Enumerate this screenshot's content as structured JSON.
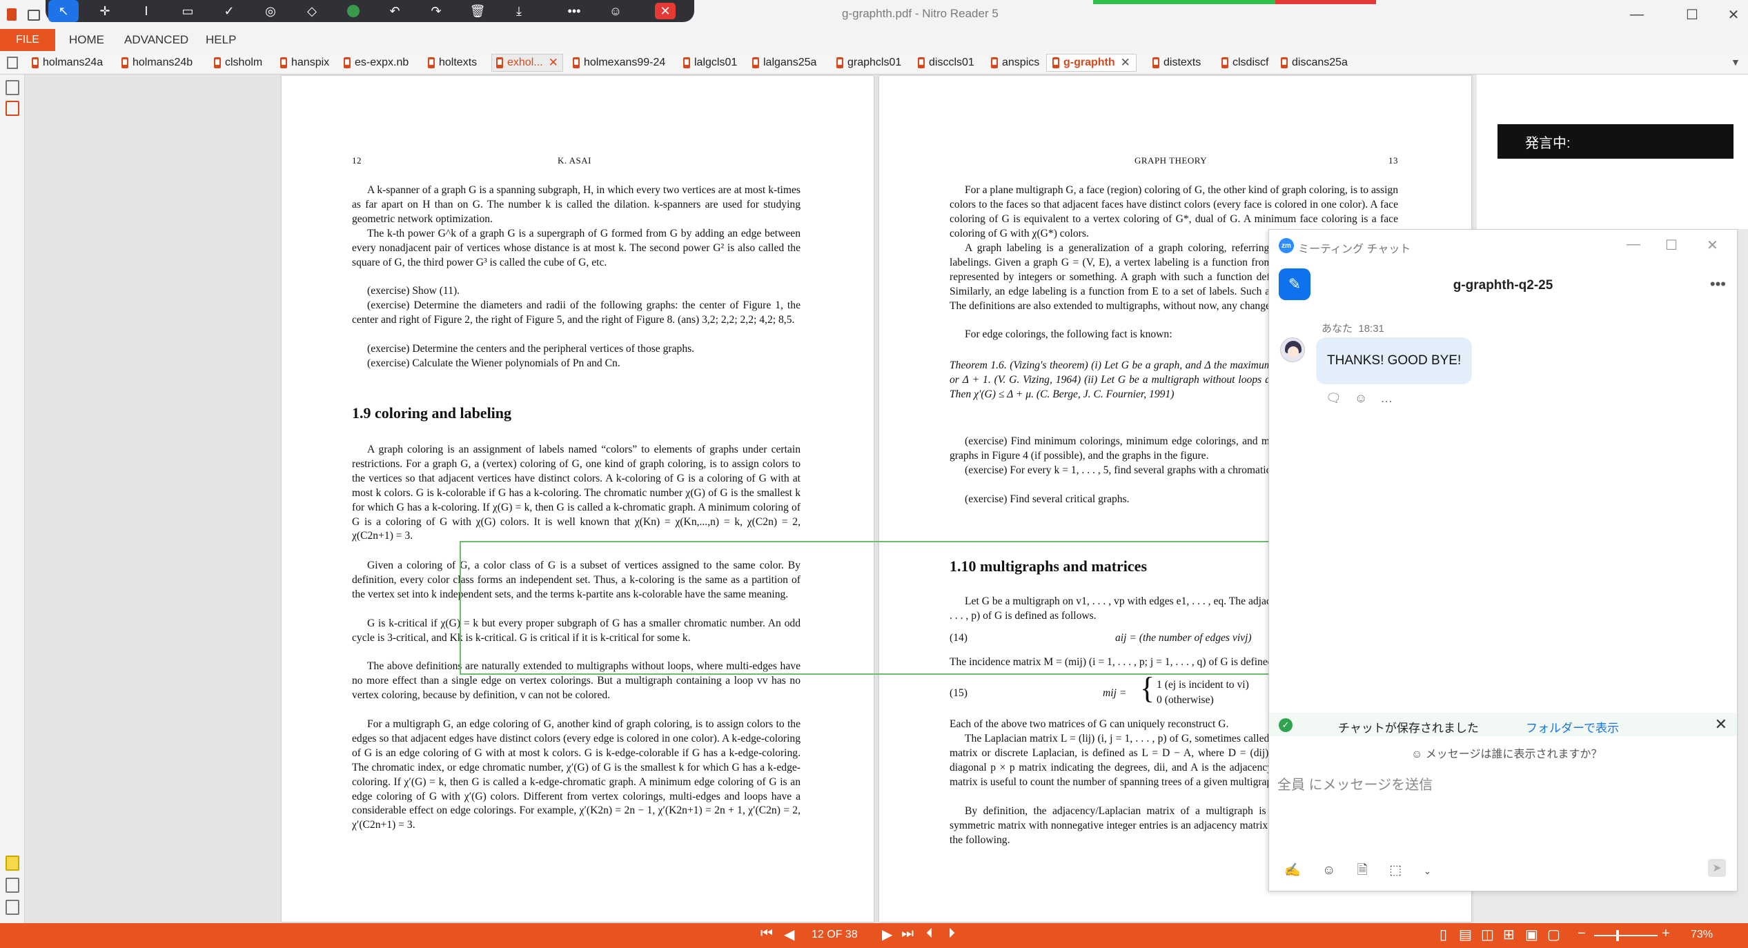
{
  "window": {
    "title": "g-graphth.pdf - Nitro Reader 5",
    "minimize": "—",
    "maximize": "☐",
    "close": "✕"
  },
  "menu": {
    "file": "FILE",
    "items": [
      "HOME",
      "ADVANCED",
      "HELP"
    ]
  },
  "tabs": [
    {
      "label": "holmans24a"
    },
    {
      "label": "holmans24b"
    },
    {
      "label": "clsholm"
    },
    {
      "label": "hanspix"
    },
    {
      "label": "es-expx.nb"
    },
    {
      "label": "holtexts"
    },
    {
      "label": "exhol...",
      "close": "✕"
    },
    {
      "label": "holmexans99-24"
    },
    {
      "label": "lalgcls01"
    },
    {
      "label": "lalgans25a"
    },
    {
      "label": "graphcls01"
    },
    {
      "label": "disccls01"
    },
    {
      "label": "anspics"
    },
    {
      "label": "g-graphth",
      "close": "✕"
    },
    {
      "label": "distexts"
    },
    {
      "label": "clsdiscf"
    },
    {
      "label": "discans25a"
    }
  ],
  "left_page": {
    "page_number": "12",
    "running_head": "K. ASAI",
    "paras_top": [
      "A k-spanner of a graph G is a spanning subgraph, H, in which every two vertices are at most k-times as far apart on H than on G. The number k is called the dilation. k-spanners are used for studying geometric network optimization.",
      "The k-th power G^k of a graph G is a supergraph of G formed from G by adding an edge between every nonadjacent pair of vertices whose distance is at most k. The second power G² is also called the square of G, the third power G³ is called the cube of G, etc.",
      "(exercise) Show (11).",
      "(exercise) Determine the diameters and radii of the following graphs: the center of Figure 1, the center and right of Figure 2, the right of Figure 5, and the right of Figure 8. (ans) 3,2; 2,2; 2,2; 4,2; 8,5.",
      "(exercise) Determine the centers and the peripheral vertices of those graphs.",
      "(exercise) Calculate the Wiener polynomials of Pn and Cn."
    ],
    "heading": "1.9  coloring and labeling",
    "paras_bottom": [
      "A graph coloring is an assignment of labels named “colors” to elements of graphs under certain restrictions. For a graph G, a (vertex) coloring of G, one kind of graph coloring, is to assign colors to the vertices so that adjacent vertices have distinct colors. A k-coloring of G is a coloring of G with at most k colors. G is k-colorable if G has a k-coloring. The chromatic number χ(G) of G is the smallest k for which G has a k-coloring. If χ(G) = k, then G is called a k-chromatic graph. A minimum coloring of G is a coloring of G with χ(G) colors. It is well known that χ(Kn) = χ(Kn,...,n) = k, χ(C2n) = 2, χ(C2n+1) = 3.",
      "Given a coloring of G, a color class of G is a subset of vertices assigned to the same color. By definition, every color class forms an independent set. Thus, a k-coloring is the same as a partition of the vertex set into k independent sets, and the terms k-partite ans k-colorable have the same meaning.",
      "G is k-critical if χ(G) = k but every proper subgraph of G has a smaller chromatic number. An odd cycle is 3-critical, and Kk is k-critical. G is critical if it is k-critical for some k.",
      "The above definitions are naturally extended to multigraphs without loops, where multi-edges have no more effect than a single edge on vertex colorings. But a multigraph containing a loop vv has no vertex coloring, because by definition, v can not be colored.",
      "For a multigraph G, an edge coloring of G, another kind of graph coloring, is to assign colors to the edges so that adjacent edges have distinct colors (every edge is colored in one color). A k-edge-coloring of G is an edge coloring of G with at most k colors. G is k-edge-colorable if G has a k-edge-coloring. The chromatic index, or edge chromatic number, χ′(G) of G is the smallest k for which G has a k-edge-coloring. If χ′(G) = k, then G is called a k-edge-chromatic graph. A minimum edge coloring of G is an edge coloring of G with χ′(G) colors. Different from vertex colorings, multi-edges and loops have a considerable effect on edge colorings. For example, χ′(K2n) = 2n − 1, χ′(K2n+1) = 2n + 1, χ′(C2n) = 2, χ′(C2n+1) = 3."
    ]
  },
  "right_page": {
    "page_number": "13",
    "running_head": "GRAPH THEORY",
    "paras_top": [
      "For a plane multigraph G, a face (region) coloring of G, the other kind of graph coloring, is to assign colors to the faces so that adjacent faces have distinct colors (every face is colored in one color). A face coloring of G is equivalent to a vertex coloring of G*, dual of G. A minimum face coloring is a face coloring of G with χ(G*) colors.",
      "A graph labeling is a generalization of a graph coloring, referring to vertex labelings or edge labelings. Given a graph G = (V, E), a vertex labeling is a function from V to a set of labels, usually represented by integers or something. A graph with such a function defined is called vertex-labeled. Similarly, an edge labeling is a function from E to a set of labels. Such a graph is called edge-labeled. The definitions are also extended to multigraphs, without now, any change.",
      "For edge colorings, the following fact is known:"
    ],
    "theorem": "Theorem 1.6. (Vizing's theorem) (i) Let G be a graph, and Δ the maximum degree of G. Then χ′(G) = Δ or Δ + 1. (V. G. Vizing, 1964) (ii) Let G be a multigraph without loops and μ be the multiplicity of G. Then χ′(G) ≤ Δ + μ. (C. Berge, J. C. Fournier, 1991)",
    "paras_mid": [
      "(exercise) Find minimum colorings, minimum edge colorings, and minimum face colorings of the graphs in Figure 4 (if possible), and the graphs in the figure.",
      "(exercise) For every k = 1, . . . , 5, find several graphs with a chromatic number of k.",
      "(exercise) Find several critical graphs."
    ],
    "heading": "1.10  multigraphs and matrices",
    "para_mat": "Let G be a multigraph on v1, . . . , vp with edges e1, . . . , eq. The adjacency matrix A = (aij) (i, j = 1, . . . , p) of G is defined as follows.",
    "eq14_num": "(14)",
    "eq14": "aij = (the number of edges vivj)",
    "para_inc": "The incidence matrix M = (mij) (i = 1, . . . , p; j = 1, . . . , q) of G is defined as follows.",
    "eq15_num": "(15)",
    "eq15_lhs": "mij =",
    "eq15_a": "1      (ej is incident to vi)",
    "eq15_b": "0      (otherwise)",
    "paras_bottom": [
      "Each of the above two matrices of G can uniquely reconstruct G.",
      "The Laplacian matrix L = (lij) (i, j = 1, . . . , p) of G, sometimes called admittance matrix, Kirchhoff matrix or discrete Laplacian, is defined as L = D − A, where D = (dij) is the degree matrix of G, a diagonal p × p matrix indicating the degrees, dii, and A is the adjacency matrix of G. The Laplacian matrix is useful to count the number of spanning trees of a given multigraph without loops.",
      "By definition, the adjacency/Laplacian matrix of a multigraph is symmetric. Conversely, any symmetric matrix with nonnegative integer entries is an adjacency matrix of some multigraph. We have the following."
    ]
  },
  "speaking_indicator": "発言中:",
  "chat": {
    "window_title": "ミーティング チャット",
    "title": "g-graphth-q2-25",
    "sender": "あなた",
    "time": "18:31",
    "message": "THANKS! GOOD BYE!",
    "saved_text": "チャットが保存されました",
    "folder_link": "フォルダーで表示",
    "who_sees": "メッセージは誰に表示されますか？",
    "input_placeholder": "全員 にメッセージを送信"
  },
  "status": {
    "page_indicator": "12 OF 38",
    "zoom": "73%"
  },
  "colors": {
    "brand": "#e8541f",
    "selection": "#6bbf6b",
    "zoom_blue": "#0e72ed"
  }
}
